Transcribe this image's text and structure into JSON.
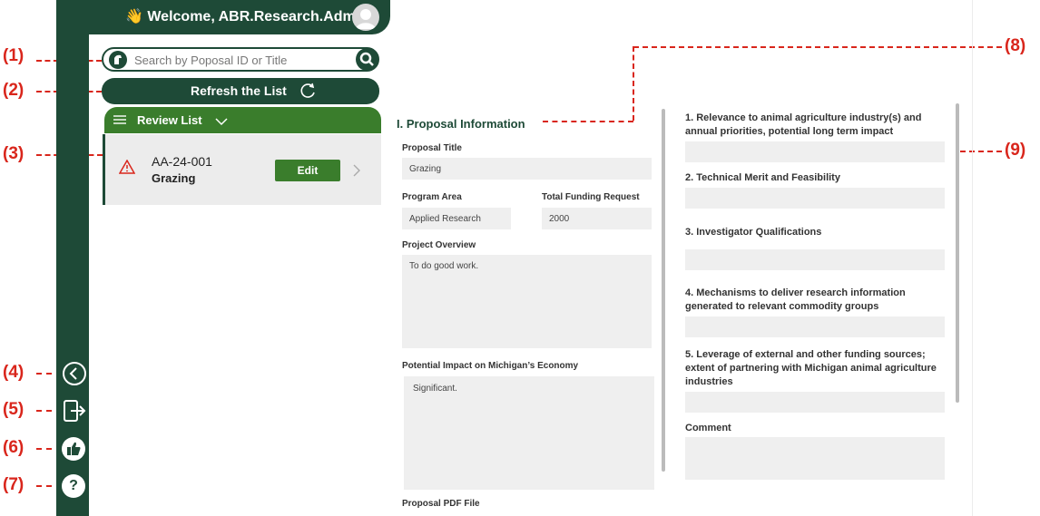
{
  "header": {
    "welcome_text": "👋 Welcome, ABR.Research.Admin"
  },
  "search": {
    "placeholder": "Search by Poposal ID or Title"
  },
  "refresh": {
    "label": "Refresh the List"
  },
  "review_list": {
    "title": "Review List",
    "items": [
      {
        "id": "AA-24-001",
        "title": "Grazing",
        "edit_label": "Edit"
      }
    ]
  },
  "proposal": {
    "section_title": "I. Proposal Information",
    "title_label": "Proposal Title",
    "title_value": "Grazing",
    "program_area_label": "Program Area",
    "program_area_value": "Applied Research",
    "funding_label": "Total Funding Request",
    "funding_value": "2000",
    "overview_label": "Project Overview",
    "overview_value": "To do good work.",
    "impact_label": "Potential Impact on Michigan’s Economy",
    "impact_value": "Significant.",
    "pdf_label": "Proposal PDF File"
  },
  "criteria": [
    "1. Relevance to animal agriculture industry(s) and annual priorities, potential long term impact",
    "2. Technical Merit and Feasibility",
    "3. Investigator Qualifications",
    "4. Mechanisms to deliver research information generated to relevant commodity groups",
    "5. Leverage of external and other funding sources; extent of partnering with Michigan animal agriculture industries",
    "Comment"
  ],
  "callouts": [
    "(1)",
    "(2)",
    "(3)",
    "(4)",
    "(5)",
    "(6)",
    "(7)",
    "(8)",
    "(9)"
  ],
  "colors": {
    "sidebar": "#1e4a37",
    "accent_green": "#3a7d2c",
    "callout_red": "#d9261c",
    "field_bg": "#efefef"
  },
  "icons": [
    "wave-icon",
    "avatar-icon",
    "spartan-logo-icon",
    "search-icon",
    "refresh-icon",
    "menu-list-icon",
    "chevron-down-icon",
    "warning-icon",
    "chevron-right-icon",
    "collapse-icon",
    "logout-icon",
    "thumbs-up-icon",
    "help-icon"
  ]
}
